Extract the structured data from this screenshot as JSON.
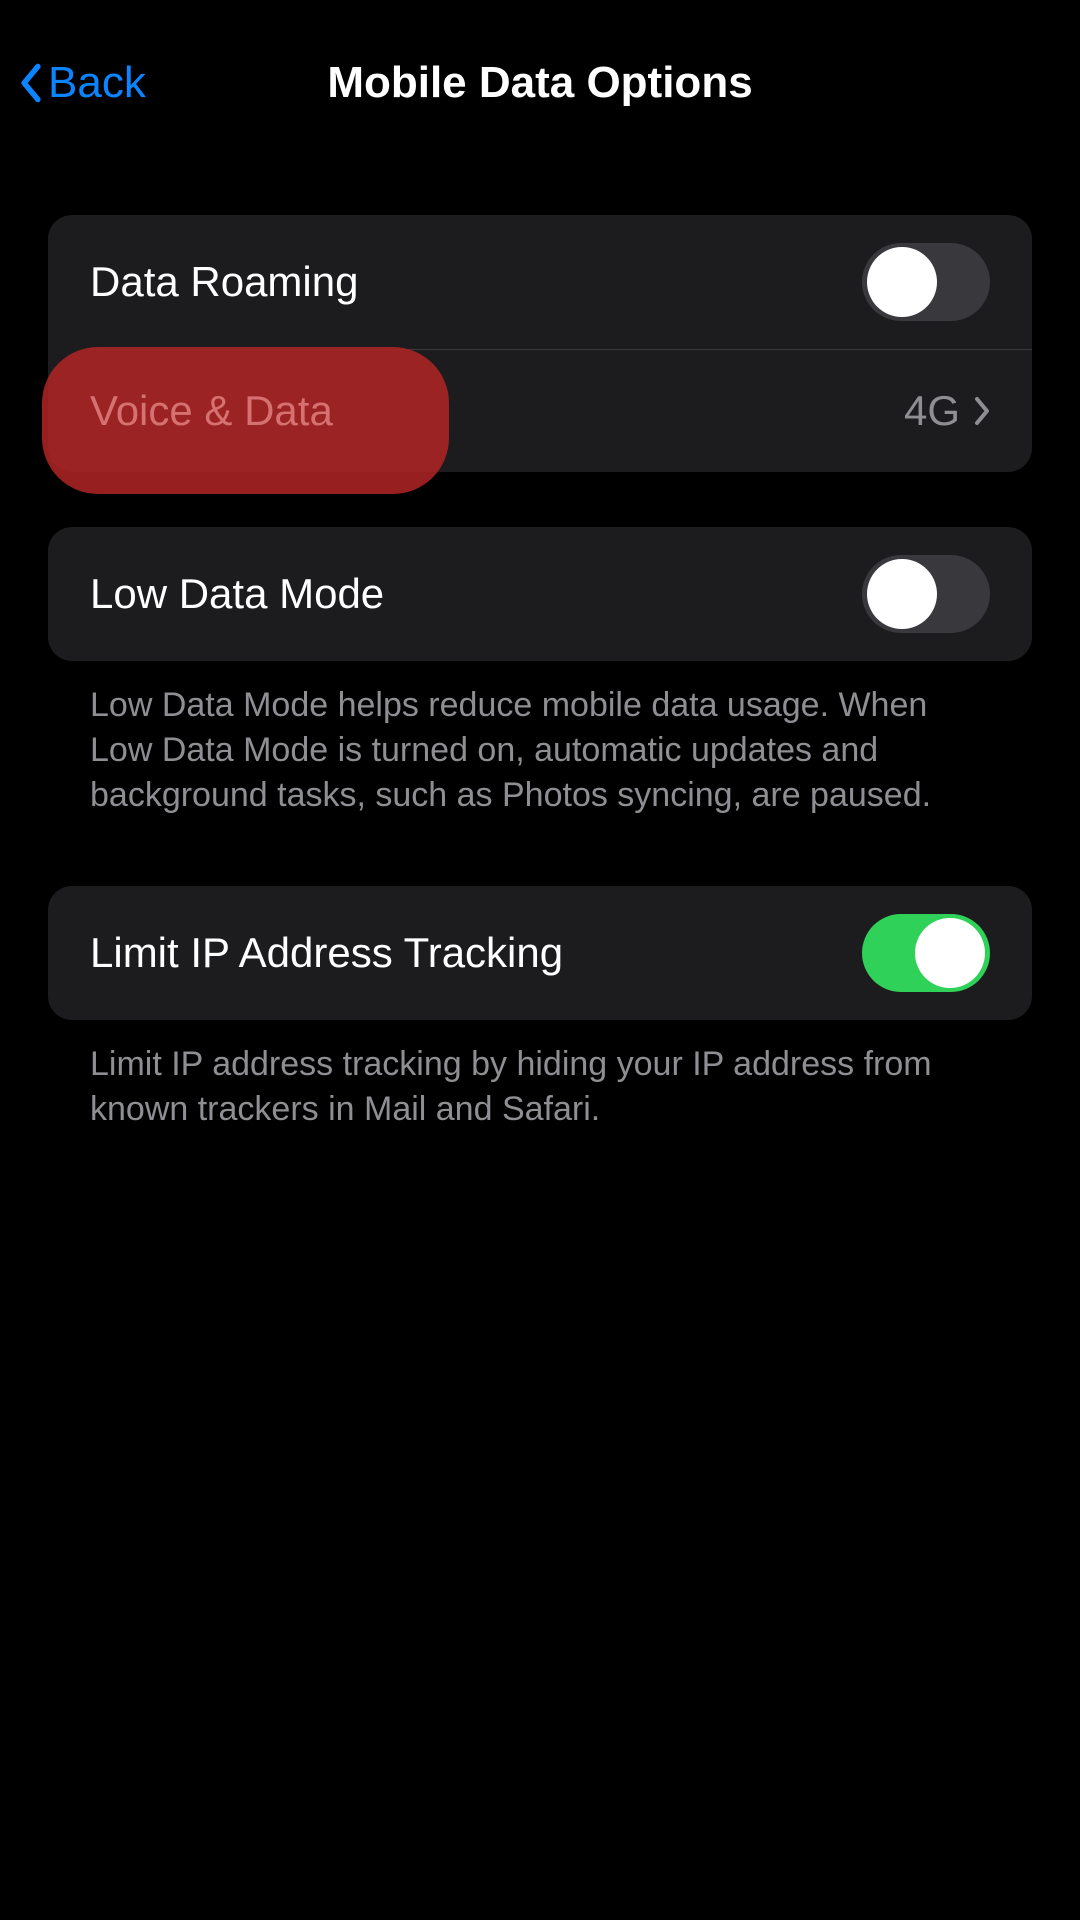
{
  "header": {
    "back_label": "Back",
    "title": "Mobile Data Options"
  },
  "group1": {
    "data_roaming": {
      "label": "Data Roaming",
      "on": false
    },
    "voice_data": {
      "label": "Voice & Data",
      "value": "4G"
    }
  },
  "group2": {
    "low_data_mode": {
      "label": "Low Data Mode",
      "on": false
    },
    "footer": "Low Data Mode helps reduce mobile data usage. When Low Data Mode is turned on, automatic updates and background tasks, such as Photos syncing, are paused."
  },
  "group3": {
    "limit_ip": {
      "label": "Limit IP Address Tracking",
      "on": true
    },
    "footer": "Limit IP address tracking by hiding your IP address from known trackers in Mail and Safari."
  }
}
